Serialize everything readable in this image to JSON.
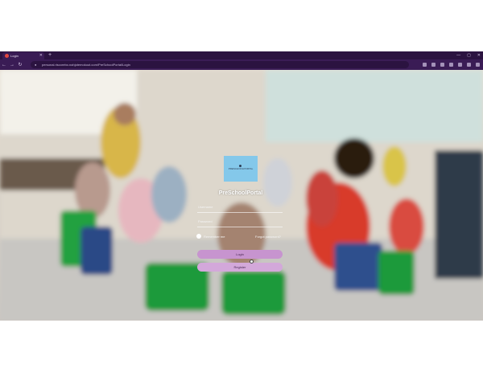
{
  "browser": {
    "tab_title": "Login",
    "new_tab": "+",
    "url": "personal.riscorebo.nahjotemokout.com/PreSchoolPortal/Login",
    "window_controls": [
      "—",
      "▢",
      "✕"
    ],
    "tab_close": "✕"
  },
  "nav": {
    "back": "←",
    "forward": "→",
    "reload": "↻",
    "lock": "🔒"
  },
  "logo": {
    "text": "PRESCHOOLPORTAL"
  },
  "page": {
    "brand_title": "PreSchoolPortal",
    "username_placeholder": "Username",
    "password_placeholder": "Password",
    "remember_label": "Remember me",
    "forgot_link": "Forgot password?",
    "login_button": "Login",
    "register_button": "Register"
  },
  "colors": {
    "chrome": "#2b1340",
    "chrome_light": "#3a1c55",
    "logo_bg": "#84c8ea",
    "button": "#c794cf"
  }
}
